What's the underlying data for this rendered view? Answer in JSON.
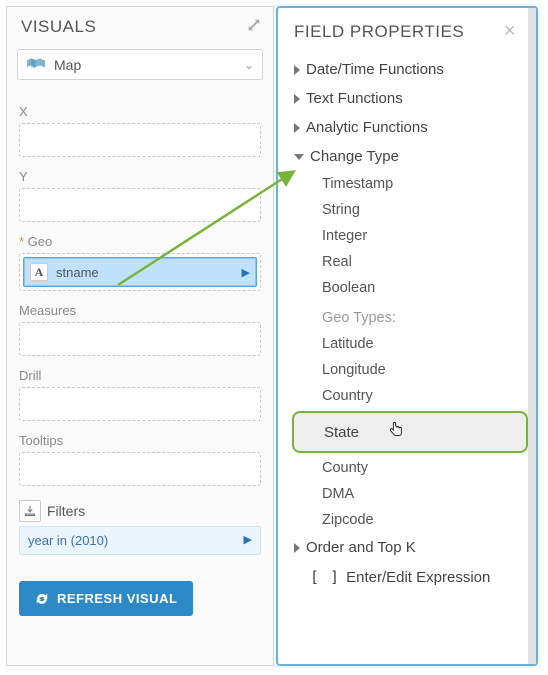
{
  "left": {
    "title": "VISUALS",
    "visType": "Map",
    "shelves": {
      "x": "X",
      "y": "Y",
      "geo": "Geo",
      "measures": "Measures",
      "drill": "Drill",
      "tooltips": "Tooltips",
      "filters": "Filters"
    },
    "geoField": {
      "typeGlyph": "A",
      "name": "stname"
    },
    "filterPill": "year in (2010)",
    "refresh": "REFRESH VISUAL"
  },
  "right": {
    "title": "FIELD PROPERTIES",
    "groups": {
      "datetime": "Date/Time Functions",
      "text": "Text Functions",
      "analytic": "Analytic Functions",
      "changeType": "Change Type",
      "orderTopK": "Order and Top K",
      "expr": "Enter/Edit Expression",
      "exprGlyph": "[ ]"
    },
    "changeType": {
      "timestamp": "Timestamp",
      "string": "String",
      "integer": "Integer",
      "real": "Real",
      "boolean": "Boolean",
      "geoHeading": "Geo Types:",
      "latitude": "Latitude",
      "longitude": "Longitude",
      "country": "Country",
      "state": "State",
      "county": "County",
      "dma": "DMA",
      "zipcode": "Zipcode"
    }
  }
}
